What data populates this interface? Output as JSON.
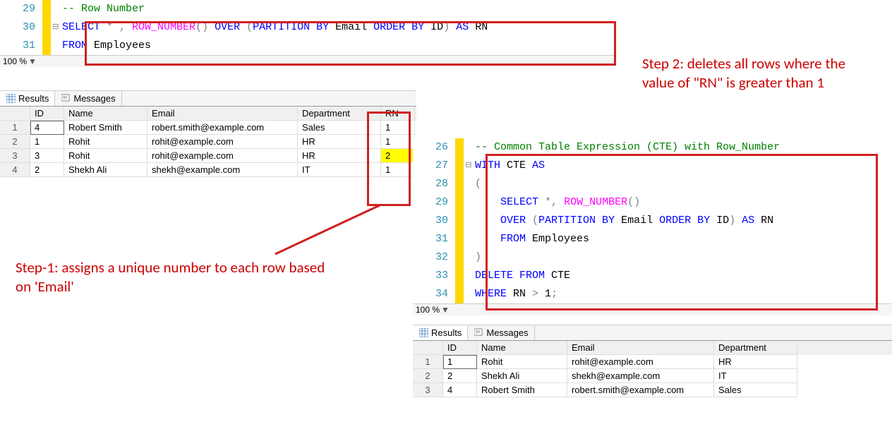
{
  "left": {
    "lines": [
      29,
      30,
      31
    ],
    "zoom": "100 %",
    "code": {
      "c29_comment": "-- Row Number",
      "c30_kw1": "SELECT ",
      "c30_op1": "* ",
      "c30_op2": ", ",
      "c30_fn": "ROW_NUMBER",
      "c30_p1": "() ",
      "c30_kw2": "OVER ",
      "c30_p2": "(",
      "c30_kw3": "PARTITION BY ",
      "c30_col1": "Email ",
      "c30_kw4": "ORDER BY ",
      "c30_col2": "ID",
      "c30_p3": ") ",
      "c30_kw5": "AS ",
      "c30_col3": "RN",
      "c31_kw1": "FROM ",
      "c31_tbl": "Employees"
    },
    "tabs": {
      "results": "Results",
      "messages": "Messages"
    },
    "columns": [
      "",
      "ID",
      "Name",
      "Email",
      "Department",
      "RN"
    ],
    "rows": [
      {
        "n": "1",
        "id": "4",
        "name": "Robert Smith",
        "email": "robert.smith@example.com",
        "dep": "Sales",
        "rn": "1",
        "sel": true
      },
      {
        "n": "2",
        "id": "1",
        "name": "Rohit",
        "email": "rohit@example.com",
        "dep": "HR",
        "rn": "1"
      },
      {
        "n": "3",
        "id": "3",
        "name": "Rohit",
        "email": "rohit@example.com",
        "dep": "HR",
        "rn": "2",
        "hl": true
      },
      {
        "n": "4",
        "id": "2",
        "name": "Shekh Ali",
        "email": "shekh@example.com",
        "dep": "IT",
        "rn": "1"
      }
    ]
  },
  "right": {
    "lines": [
      26,
      27,
      28,
      29,
      30,
      31,
      32,
      33,
      34
    ],
    "zoom": "100 %",
    "code": {
      "c26_comment": "-- Common Table Expression (CTE) with Row_Number",
      "c27_kw1": "WITH ",
      "c27_id": "CTE ",
      "c27_kw2": "AS",
      "c28_p": "(",
      "c29_pad": "    ",
      "c29_kw1": "SELECT ",
      "c29_op1": "*",
      "c29_op2": ", ",
      "c29_fn": "ROW_NUMBER",
      "c29_p1": "()",
      "c30_pad": "    ",
      "c30_kw1": "OVER ",
      "c30_p1": "(",
      "c30_kw2": "PARTITION BY ",
      "c30_c1": "Email ",
      "c30_kw3": "ORDER BY ",
      "c30_c2": "ID",
      "c30_p2": ") ",
      "c30_kw4": "AS ",
      "c30_c3": "RN",
      "c31_pad": "    ",
      "c31_kw1": "FROM ",
      "c31_tbl": "Employees",
      "c32_p": ")",
      "c33_kw1": "DELETE ",
      "c33_kw2": "FROM ",
      "c33_id": "CTE",
      "c34_kw1": "WHERE ",
      "c34_c1": "RN ",
      "c34_op": "> ",
      "c34_n": "1",
      "c34_sc": ";"
    },
    "tabs": {
      "results": "Results",
      "messages": "Messages"
    },
    "columns": [
      "",
      "ID",
      "Name",
      "Email",
      "Department"
    ],
    "rows": [
      {
        "n": "1",
        "id": "1",
        "name": "Rohit",
        "email": "rohit@example.com",
        "dep": "HR",
        "sel": true
      },
      {
        "n": "2",
        "id": "2",
        "name": "Shekh Ali",
        "email": "shekh@example.com",
        "dep": "IT"
      },
      {
        "n": "3",
        "id": "4",
        "name": "Robert Smith",
        "email": "robert.smith@example.com",
        "dep": "Sales"
      }
    ]
  },
  "annot": {
    "step1": "Step-1: assigns a unique number to each row based on 'Email'",
    "step2": "Step 2: deletes all rows where the value of \"RN\" is greater than 1"
  },
  "chart_data": {
    "type": "table",
    "left_result": {
      "columns": [
        "ID",
        "Name",
        "Email",
        "Department",
        "RN"
      ],
      "rows": [
        [
          4,
          "Robert Smith",
          "robert.smith@example.com",
          "Sales",
          1
        ],
        [
          1,
          "Rohit",
          "rohit@example.com",
          "HR",
          1
        ],
        [
          3,
          "Rohit",
          "rohit@example.com",
          "HR",
          2
        ],
        [
          2,
          "Shekh Ali",
          "shekh@example.com",
          "IT",
          1
        ]
      ]
    },
    "right_result": {
      "columns": [
        "ID",
        "Name",
        "Email",
        "Department"
      ],
      "rows": [
        [
          1,
          "Rohit",
          "rohit@example.com",
          "HR"
        ],
        [
          2,
          "Shekh Ali",
          "shekh@example.com",
          "IT"
        ],
        [
          4,
          "Robert Smith",
          "robert.smith@example.com",
          "Sales"
        ]
      ]
    }
  }
}
